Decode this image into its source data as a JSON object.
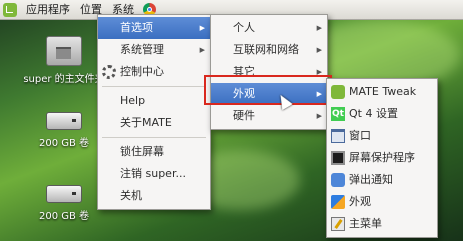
{
  "panel": {
    "apps": "应用程序",
    "places": "位置",
    "system": "系统",
    "logo_icon": "mate-logo",
    "browser_icon": "chromium-icon"
  },
  "desktop": {
    "home_label": "super 的主文件夹",
    "drive1_label": "200 GB 卷",
    "drive2_label": "200 GB 卷"
  },
  "system_menu": {
    "preferences": "首选项",
    "admin": "系统管理",
    "control_center": "控制中心",
    "help": "Help",
    "about": "关于MATE",
    "lock": "锁住屏幕",
    "logout": "注销 super...",
    "shutdown": "关机"
  },
  "preferences_menu": {
    "personal": "个人",
    "internet": "互联网和网络",
    "other": "其它",
    "appearance": "外观",
    "hardware": "硬件"
  },
  "appearance_menu": {
    "mate_tweak": "MATE Tweak",
    "qt4": "Qt 4 设置",
    "windows": "窗口",
    "screensaver": "屏幕保护程序",
    "notifications": "弹出通知",
    "appearance": "外观",
    "main_menu": "主菜单"
  },
  "colors": {
    "selection": "#3b6fc1",
    "annotation": "#d9281e"
  }
}
